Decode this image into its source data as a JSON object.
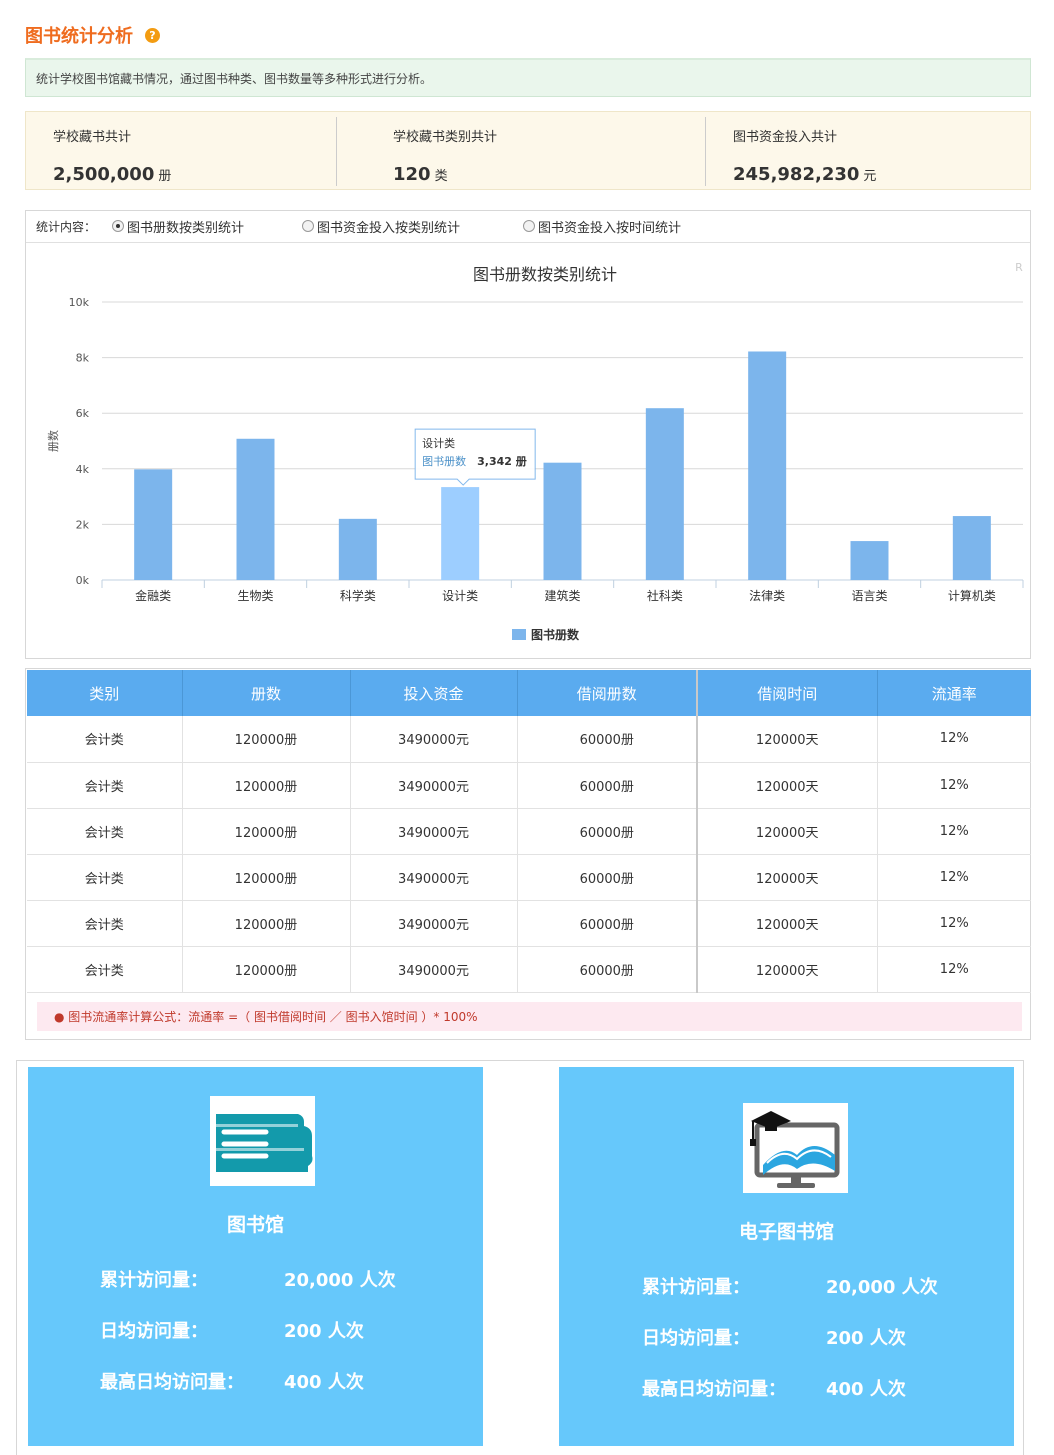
{
  "header": {
    "title": "图书统计分析",
    "help_glyph": "?",
    "description": "统计学校图书馆藏书情况，通过图书种类、图书数量等多种形式进行分析。"
  },
  "summary": [
    {
      "label": "学校藏书共计",
      "value": "2,500,000",
      "unit": "册"
    },
    {
      "label": "学校藏书类别共计",
      "value": "120",
      "unit": "类"
    },
    {
      "label": "图书资金投入共计",
      "value": "245,982,230",
      "unit": "元"
    }
  ],
  "radio_group": {
    "lead": "统计内容：",
    "options": [
      "图书册数按类别统计",
      "图书资金投入按类别统计",
      "图书资金投入按时间统计"
    ],
    "selected_index": 0
  },
  "chart_data": {
    "type": "bar",
    "title": "图书册数按类别统计",
    "ylabel": "册数",
    "xlabel": "",
    "ylim": [
      0,
      10000
    ],
    "y_ticks": [
      "0k",
      "2k",
      "4k",
      "6k",
      "8k",
      "10k"
    ],
    "categories": [
      "金融类",
      "生物类",
      "科学类",
      "设计类",
      "建筑类",
      "社科类",
      "法律类",
      "语言类",
      "计算机类"
    ],
    "series": [
      {
        "name": "图书册数",
        "values": [
          3980,
          5080,
          2200,
          3342,
          4220,
          6180,
          8220,
          1400,
          2300
        ]
      }
    ],
    "legend_position": "bottom",
    "highlight_index": 3,
    "tooltip": {
      "category": "设计类",
      "series": "图书册数",
      "value": "3,342 册"
    },
    "corner_mark": "R",
    "colors": {
      "bar": "#7cb5ec",
      "bar_hover": "#9dceff",
      "grid": "#d8d8d8"
    }
  },
  "table": {
    "headers": [
      "类别",
      "册数",
      "投入资金",
      "借阅册数",
      "借阅时间",
      "流通率"
    ],
    "rows": [
      [
        "会计类",
        "120000册",
        "3490000元",
        "60000册",
        "120000天",
        "12%"
      ],
      [
        "会计类",
        "120000册",
        "3490000元",
        "60000册",
        "120000天",
        "12%"
      ],
      [
        "会计类",
        "120000册",
        "3490000元",
        "60000册",
        "120000天",
        "12%"
      ],
      [
        "会计类",
        "120000册",
        "3490000元",
        "60000册",
        "120000天",
        "12%"
      ],
      [
        "会计类",
        "120000册",
        "3490000元",
        "60000册",
        "120000天",
        "12%"
      ],
      [
        "会计类",
        "120000册",
        "3490000元",
        "60000册",
        "120000天",
        "12%"
      ]
    ],
    "formula": "● 图书流通率计算公式：流通率 =（ 图书借阅时间 ／ 图书入馆时间 ）* 100%"
  },
  "libraries": [
    {
      "name": "图书馆",
      "icon": "books-icon",
      "stats": [
        {
          "label": "累计访问量：",
          "value": "20,000 人次"
        },
        {
          "label": "日均访问量：",
          "value": "200 人次"
        },
        {
          "label": "最高日均访问量：",
          "value": "400 人次"
        }
      ]
    },
    {
      "name": "电子图书馆",
      "icon": "e-library-icon",
      "stats": [
        {
          "label": "累计访问量：",
          "value": "20,000 人次"
        },
        {
          "label": "日均访问量：",
          "value": "200 人次"
        },
        {
          "label": "最高日均访问量：",
          "value": "400 人次"
        }
      ]
    }
  ],
  "colors": {
    "title_orange": "#ef6c1f",
    "table_header": "#5aabef",
    "card_blue": "#66c8fb"
  }
}
